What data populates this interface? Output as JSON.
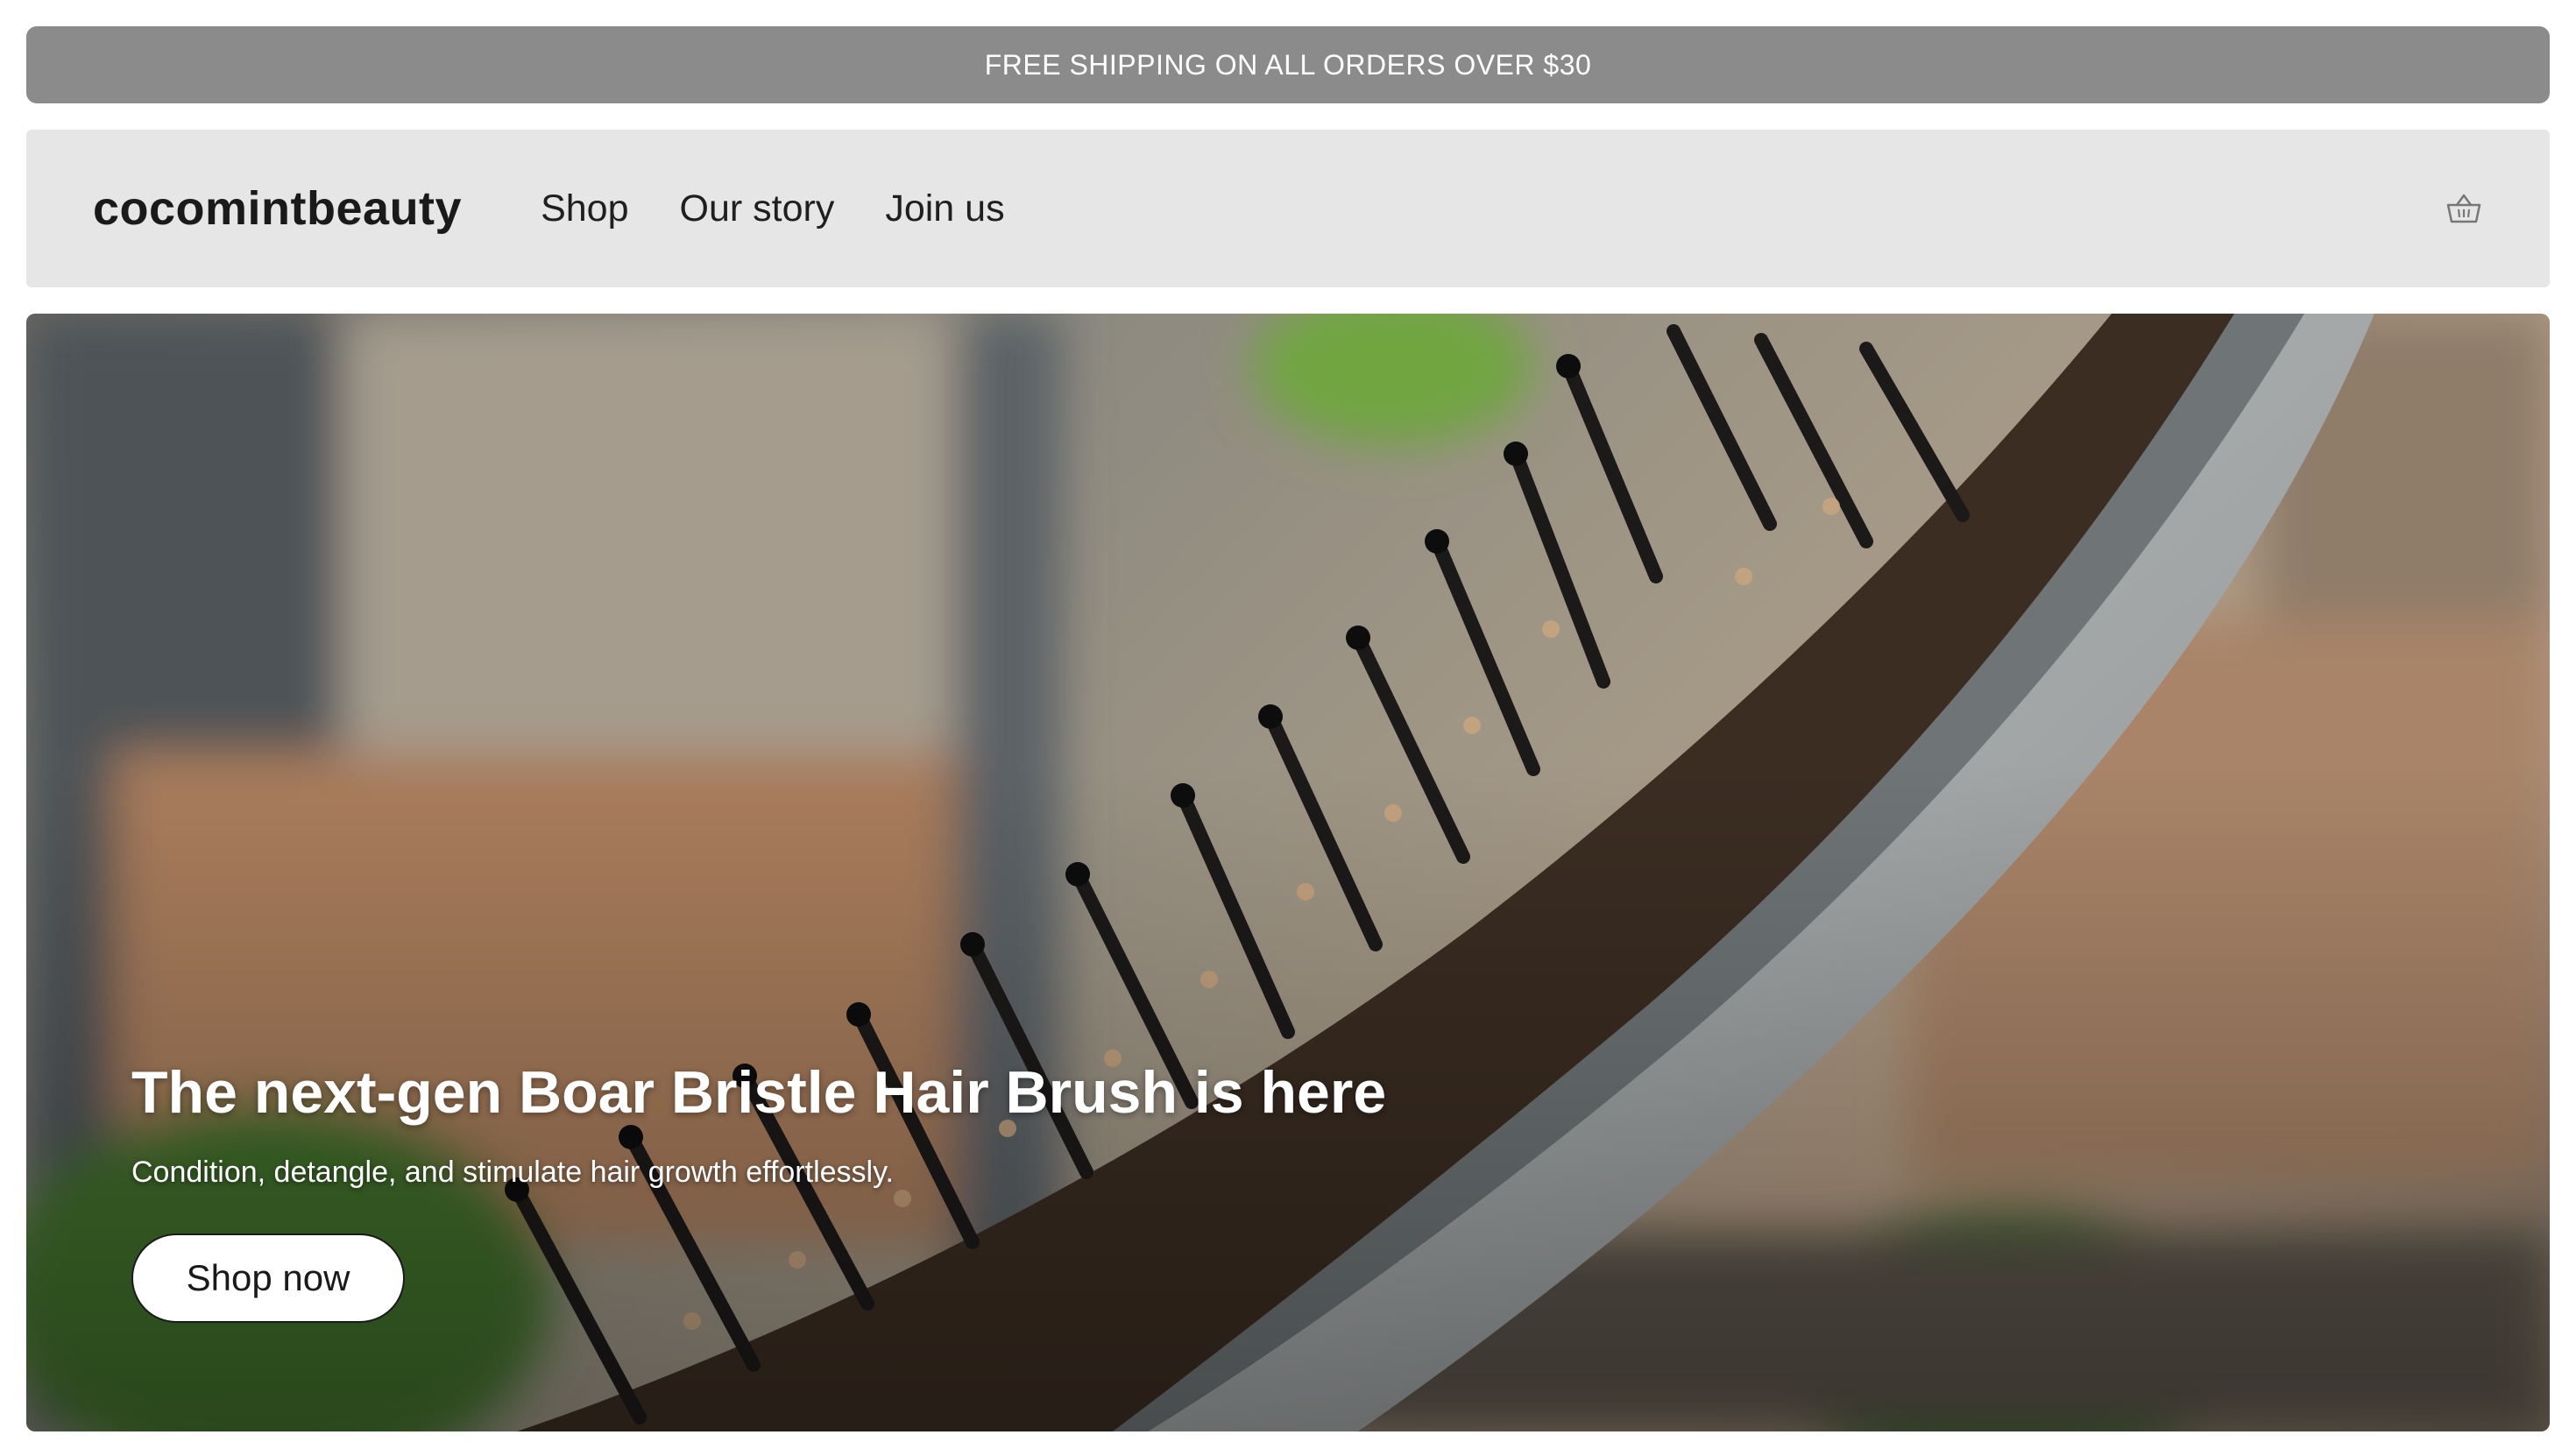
{
  "announcement": {
    "text": "FREE SHIPPING ON ALL ORDERS OVER $30"
  },
  "header": {
    "logo": "cocomintbeauty",
    "nav": [
      {
        "label": "Shop"
      },
      {
        "label": "Our story"
      },
      {
        "label": "Join us"
      }
    ],
    "cart_icon": "basket-icon"
  },
  "hero": {
    "title": "The next-gen Boar Bristle Hair Brush is here",
    "subtitle": "Condition, detangle, and stimulate hair growth effortlessly.",
    "cta_label": "Shop now",
    "image": "boar-bristle-hair-brush-photo"
  },
  "colors": {
    "announcement_bg": "#8b8b8b",
    "header_bg": "#e6e6e6",
    "text": "#1a1a1a",
    "hero_text": "#ffffff"
  }
}
